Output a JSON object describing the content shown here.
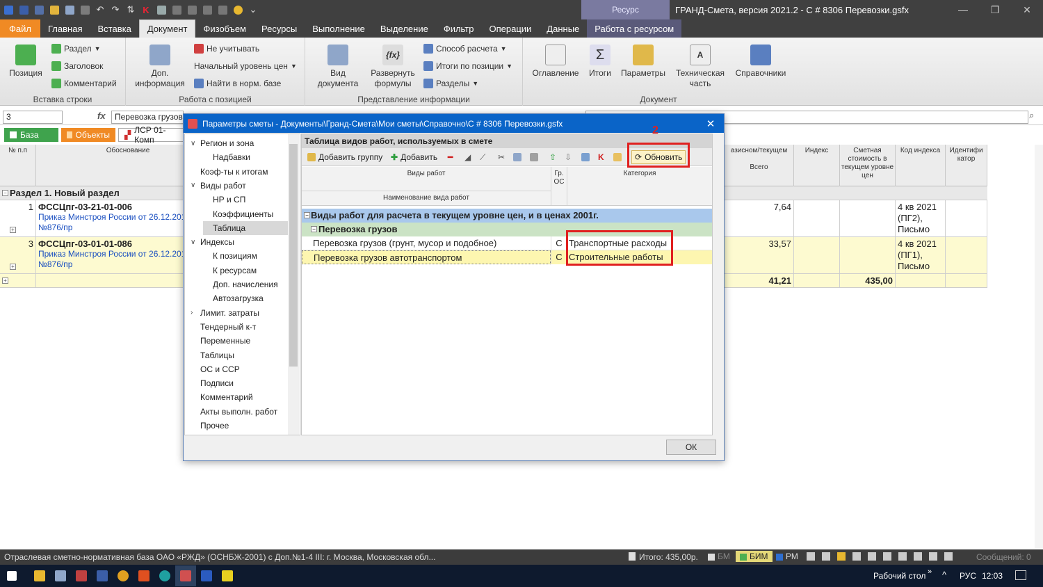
{
  "window": {
    "title": "ГРАНД-Смета, версия 2021.2 - С # 8306 Перевозки.gsfx",
    "ctx_tab": "Ресурс"
  },
  "tabs": [
    "Файл",
    "Главная",
    "Вставка",
    "Документ",
    "Физобъем",
    "Ресурсы",
    "Выполнение",
    "Выделение",
    "Фильтр",
    "Операции",
    "Данные",
    "Работа с ресурсом"
  ],
  "ribbon": {
    "g1": {
      "label": "Вставка строки",
      "position": "Позиция",
      "razdel": "Раздел",
      "zagolovok": "Заголовок",
      "kommentariy": "Комментарий"
    },
    "g2": {
      "label": "Работа с позицией",
      "dop1": "Доп.",
      "dop2": "информация",
      "ne_uchit": "Не учитывать",
      "nach_uroven": "Начальный уровень цен",
      "nayti": "Найти в норм. базе"
    },
    "g3": {
      "label": "Представление информации",
      "vid1": "Вид",
      "vid2": "документа",
      "razv1": "Развернуть",
      "razv2": "формулы",
      "sposob": "Способ расчета",
      "itogi_poz": "Итоги по позиции",
      "razdely": "Разделы"
    },
    "g4": {
      "label": "Документ",
      "oglavl": "Оглавление",
      "itogi": "Итоги",
      "parametry": "Параметры",
      "tech1": "Техническая",
      "tech2": "часть",
      "sprav": "Справочники"
    }
  },
  "formula": {
    "cell": "3",
    "value": "Перевозка грузов"
  },
  "doctabs": [
    "База",
    "Объекты",
    "ЛСР 01-Комп"
  ],
  "sheet": {
    "headers": {
      "num": "№ п.п",
      "obosn": "Обоснование",
      "bazis": "азисном/текущем",
      "vsego": "Всего",
      "index": "Индекс",
      "smet": "Сметная стоимость в текущем уровне цен",
      "kod": "Код индекса",
      "ident": "Идентифи катор"
    },
    "section": "Раздел 1. Новый раздел",
    "rows": [
      {
        "num": "1",
        "code": "ФССЦпг-03-21-01-006",
        "ref1": "Приказ Минстроя России от 26.12.2019",
        "ref2": "№876/пр",
        "vsego": "7,64",
        "kod1": "4 кв 2021",
        "kod2": "(ПГ2),",
        "kod3": "Письмо"
      },
      {
        "num": "3",
        "code": "ФССЦпг-03-01-01-086",
        "ref1": "Приказ Минстроя России от 26.12.2019",
        "ref2": "№876/пр",
        "vsego": "33,57",
        "kod1": "4 кв 2021",
        "kod2": "(ПГ1),",
        "kod3": "Письмо"
      }
    ],
    "total_vsego": "41,21",
    "total_smet": "435,00"
  },
  "dialog": {
    "title": "Параметры сметы - Документы\\Гранд-Смета\\Мои сметы\\Справочно\\С # 8306 Перевозки.gsfx",
    "tree": [
      {
        "label": "Регион и зона",
        "level": 0,
        "caret": "∨"
      },
      {
        "label": "Надбавки",
        "level": 1,
        "caret": ""
      },
      {
        "label": "Коэф-ты к итогам",
        "level": 0,
        "caret": ""
      },
      {
        "label": "Виды работ",
        "level": 0,
        "caret": "∨"
      },
      {
        "label": "НР и СП",
        "level": 1,
        "caret": ""
      },
      {
        "label": "Коэффициенты",
        "level": 1,
        "caret": ""
      },
      {
        "label": "Таблица",
        "level": 1,
        "caret": "",
        "selected": true
      },
      {
        "label": "Индексы",
        "level": 0,
        "caret": "∨"
      },
      {
        "label": "К позициям",
        "level": 1,
        "caret": ""
      },
      {
        "label": "К ресурсам",
        "level": 1,
        "caret": ""
      },
      {
        "label": "Доп. начисления",
        "level": 1,
        "caret": ""
      },
      {
        "label": "Автозагрузка",
        "level": 1,
        "caret": ""
      },
      {
        "label": "Лимит. затраты",
        "level": 0,
        "caret": "›"
      },
      {
        "label": "Тендерный к-т",
        "level": 0,
        "caret": ""
      },
      {
        "label": "Переменные",
        "level": 0,
        "caret": ""
      },
      {
        "label": "Таблицы",
        "level": 0,
        "caret": ""
      },
      {
        "label": "ОС и ССР",
        "level": 0,
        "caret": ""
      },
      {
        "label": "Подписи",
        "level": 0,
        "caret": ""
      },
      {
        "label": "Комментарий",
        "level": 0,
        "caret": ""
      },
      {
        "label": "Акты выполн. работ",
        "level": 0,
        "caret": ""
      },
      {
        "label": "Прочее",
        "level": 0,
        "caret": ""
      }
    ],
    "pane_title": "Таблица видов работ, используемых в смете",
    "toolbar": {
      "add_group": "Добавить группу",
      "add": "Добавить",
      "refresh": "Обновить"
    },
    "grid_headers": {
      "vidy": "Виды работ",
      "naim": "Наименование вида работ",
      "gr1": "Гр.",
      "gr2": "ОС",
      "kat": "Категория"
    },
    "group_row": "Виды работ для расчета в текущем уровне цен, и в ценах 2001г.",
    "subgroup": "Перевозка грузов",
    "items": [
      {
        "name": "Перевозка грузов (грунт, мусор и подобное)",
        "os": "С",
        "kat": "Транспортные расходы"
      },
      {
        "name": "Перевозка грузов автотранспортом",
        "os": "С",
        "kat": "Строительные работы"
      }
    ],
    "ok": "ОК",
    "annotation": "2"
  },
  "status": {
    "left": "Отраслевая сметно-нормативная база ОАО «РЖД» (ОСНБЖ-2001) с Доп.№1-4  III: г. Москва, Московская обл...",
    "itogo": "Итого: 435,00р.",
    "bm": "БМ",
    "bim": "БИМ",
    "rm": "РМ",
    "msgs": "Сообщений: 0"
  },
  "taskbar": {
    "desktop": "Рабочий стол",
    "lang": "РУС",
    "time": "12:03"
  }
}
